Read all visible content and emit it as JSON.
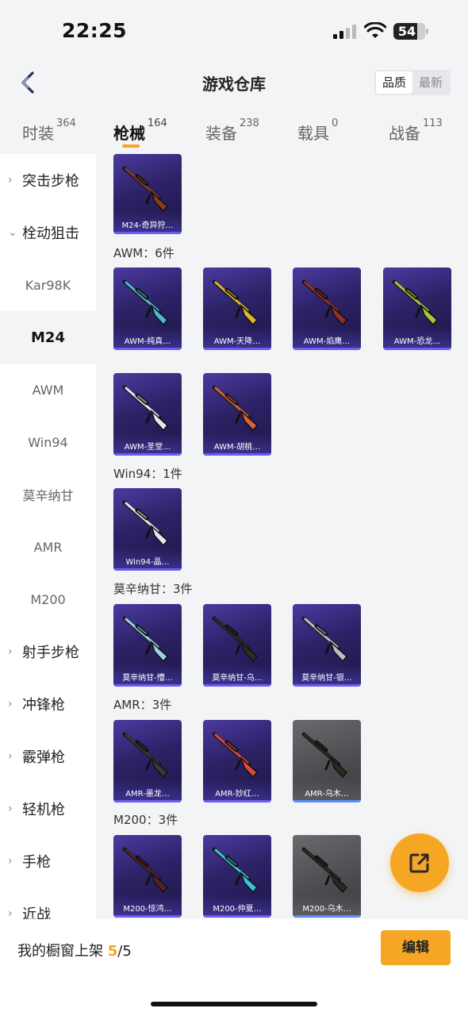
{
  "status": {
    "time": "22:25",
    "battery": "54"
  },
  "nav": {
    "title": "游戏仓库",
    "sort_options": [
      "品质",
      "最新"
    ],
    "sort_selected": "品质"
  },
  "tabs": [
    {
      "label": "时装",
      "count": "364"
    },
    {
      "label": "枪械",
      "count": "164"
    },
    {
      "label": "装备",
      "count": "238"
    },
    {
      "label": "载具",
      "count": "0"
    },
    {
      "label": "战备",
      "count": "113"
    }
  ],
  "sidebar": {
    "items": [
      {
        "label": "突击步枪",
        "type": "group",
        "chev": "›"
      },
      {
        "label": "栓动狙击",
        "type": "group",
        "chev": "⌄"
      },
      {
        "label": "Kar98K",
        "type": "sub"
      },
      {
        "label": "M24",
        "type": "sub-selected"
      },
      {
        "label": "AWM",
        "type": "sub"
      },
      {
        "label": "Win94",
        "type": "sub"
      },
      {
        "label": "莫辛纳甘",
        "type": "sub"
      },
      {
        "label": "AMR",
        "type": "sub"
      },
      {
        "label": "M200",
        "type": "sub"
      },
      {
        "label": "射手步枪",
        "type": "group",
        "chev": "›"
      },
      {
        "label": "冲锋枪",
        "type": "group",
        "chev": "›"
      },
      {
        "label": "霰弹枪",
        "type": "group",
        "chev": "›"
      },
      {
        "label": "轻机枪",
        "type": "group",
        "chev": "›"
      },
      {
        "label": "手枪",
        "type": "group",
        "chev": "›"
      },
      {
        "label": "近战",
        "type": "group",
        "chev": "›"
      }
    ]
  },
  "sections": [
    {
      "title": "",
      "items": [
        {
          "label": "M24-奇异狩…",
          "color": "#8b3a2a",
          "grey": false
        }
      ]
    },
    {
      "title": "AWM：6件",
      "items": [
        {
          "label": "AWM-纯真…",
          "color": "#4fb8d6",
          "grey": false
        },
        {
          "label": "AWM-天降…",
          "color": "#e0b530",
          "grey": false
        },
        {
          "label": "AWM-焰鹰…",
          "color": "#9a2f2a",
          "grey": false
        },
        {
          "label": "AWM-恐龙…",
          "color": "#a7c83a",
          "grey": false
        },
        {
          "label": "AWM-圣堂…",
          "color": "#e8e4f0",
          "grey": false
        },
        {
          "label": "AWM-胡桃…",
          "color": "#d7643a",
          "grey": false
        }
      ]
    },
    {
      "title": "Win94：1件",
      "items": [
        {
          "label": "Win94-晶…",
          "color": "#e4e6ef",
          "grey": false
        }
      ]
    },
    {
      "title": "莫辛纳甘：3件",
      "items": [
        {
          "label": "莫辛纳甘-懵…",
          "color": "#9fd0e6",
          "grey": false
        },
        {
          "label": "莫辛纳甘-乌…",
          "color": "#2b2b2b",
          "grey": false
        },
        {
          "label": "莫辛纳甘-银…",
          "color": "#b8bccb",
          "grey": false
        }
      ]
    },
    {
      "title": "AMR：3件",
      "items": [
        {
          "label": "AMR-墨龙…",
          "color": "#3a3a3a",
          "grey": false
        },
        {
          "label": "AMR-妙红…",
          "color": "#d84a3a",
          "grey": false
        },
        {
          "label": "AMR-乌木…",
          "color": "#2a2a22",
          "grey": true
        }
      ]
    },
    {
      "title": "M200：3件",
      "items": [
        {
          "label": "M200-惊鸿…",
          "color": "#5a1f2a",
          "grey": false
        },
        {
          "label": "M200-仲夏…",
          "color": "#3ec0d8",
          "grey": false
        },
        {
          "label": "M200-乌木…",
          "color": "#2a2a22",
          "grey": true
        }
      ]
    }
  ],
  "bottom": {
    "prefix": "我的橱窗上架 ",
    "count": "5",
    "suffix": "/5",
    "edit_label": "编辑"
  },
  "colors": {
    "accent": "#f5a623",
    "card_purple": "#2c2266"
  }
}
